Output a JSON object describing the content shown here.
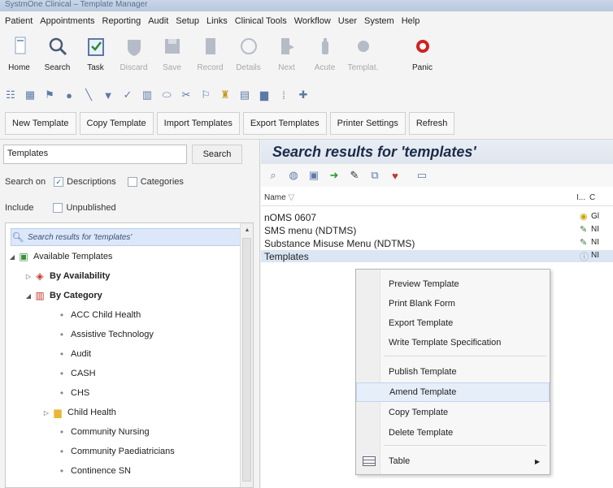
{
  "window": {
    "title": "SystmOne Clinical – Template Manager"
  },
  "menu": [
    "Patient",
    "Appointments",
    "Reporting",
    "Audit",
    "Setup",
    "Links",
    "Clinical Tools",
    "Workflow",
    "User",
    "System",
    "Help"
  ],
  "toolbar": {
    "buttons": [
      {
        "label": "Home",
        "icon": "home-icon",
        "enabled": true
      },
      {
        "label": "Search",
        "icon": "search-icon",
        "enabled": true
      },
      {
        "label": "Task",
        "icon": "task-icon",
        "enabled": true
      },
      {
        "label": "Discard",
        "icon": "shield-icon",
        "enabled": false
      },
      {
        "label": "Save",
        "icon": "save-icon",
        "enabled": false
      },
      {
        "label": "Record",
        "icon": "record-icon",
        "enabled": false
      },
      {
        "label": "Details",
        "icon": "details-icon",
        "enabled": false
      },
      {
        "label": "Next",
        "icon": "next-icon",
        "enabled": false
      },
      {
        "label": "Acute",
        "icon": "acute-icon",
        "enabled": false
      },
      {
        "label": "Templat.",
        "icon": "template-icon",
        "enabled": false
      },
      {
        "label": "Panic",
        "icon": "panic-icon",
        "enabled": true
      }
    ]
  },
  "template_toolbar": [
    "New Template",
    "Copy Template",
    "Import Templates",
    "Export Templates",
    "Printer Settings",
    "Refresh"
  ],
  "left": {
    "search_value": "Templates",
    "search_button": "Search",
    "search_on_label": "Search on",
    "descriptions_label": "Descriptions",
    "categories_label": "Categories",
    "include_label": "Include",
    "unpublished_label": "Unpublished"
  },
  "tree": [
    {
      "label": "Search results for 'templates'",
      "level": 0
    },
    {
      "label": "Available Templates",
      "level": 0
    },
    {
      "label": "By Availability",
      "level": 1
    },
    {
      "label": "By Category",
      "level": 1
    },
    {
      "label": "ACC Child Health",
      "level": 2
    },
    {
      "label": "Assistive Technology",
      "level": 2
    },
    {
      "label": "Audit",
      "level": 2
    },
    {
      "label": "CASH",
      "level": 2
    },
    {
      "label": "CHS",
      "level": 2
    },
    {
      "label": "Child Health",
      "level": 2
    },
    {
      "label": "Community Nursing",
      "level": 2
    },
    {
      "label": "Community Paediatricians",
      "level": 2
    },
    {
      "label": "Continence SN",
      "level": 2
    }
  ],
  "results": {
    "title": "Search results for 'templates'",
    "col_name": "Name",
    "col_i": "I...",
    "col_c": "C",
    "rows": [
      {
        "name": "nOMS 0607",
        "tag": "Gl"
      },
      {
        "name": "SMS menu (NDTMS)",
        "tag": "NI"
      },
      {
        "name": "Substance Misuse Menu (NDTMS)",
        "tag": "NI"
      },
      {
        "name": "Templates",
        "tag": "NI"
      }
    ]
  },
  "context_menu": {
    "items": [
      "Preview Template",
      "Print Blank Form",
      "Export Template",
      "Write Template Specification",
      "Publish Template",
      "Amend Template",
      "Copy Template",
      "Delete Template",
      "Table"
    ],
    "highlighted": "Amend Template"
  }
}
